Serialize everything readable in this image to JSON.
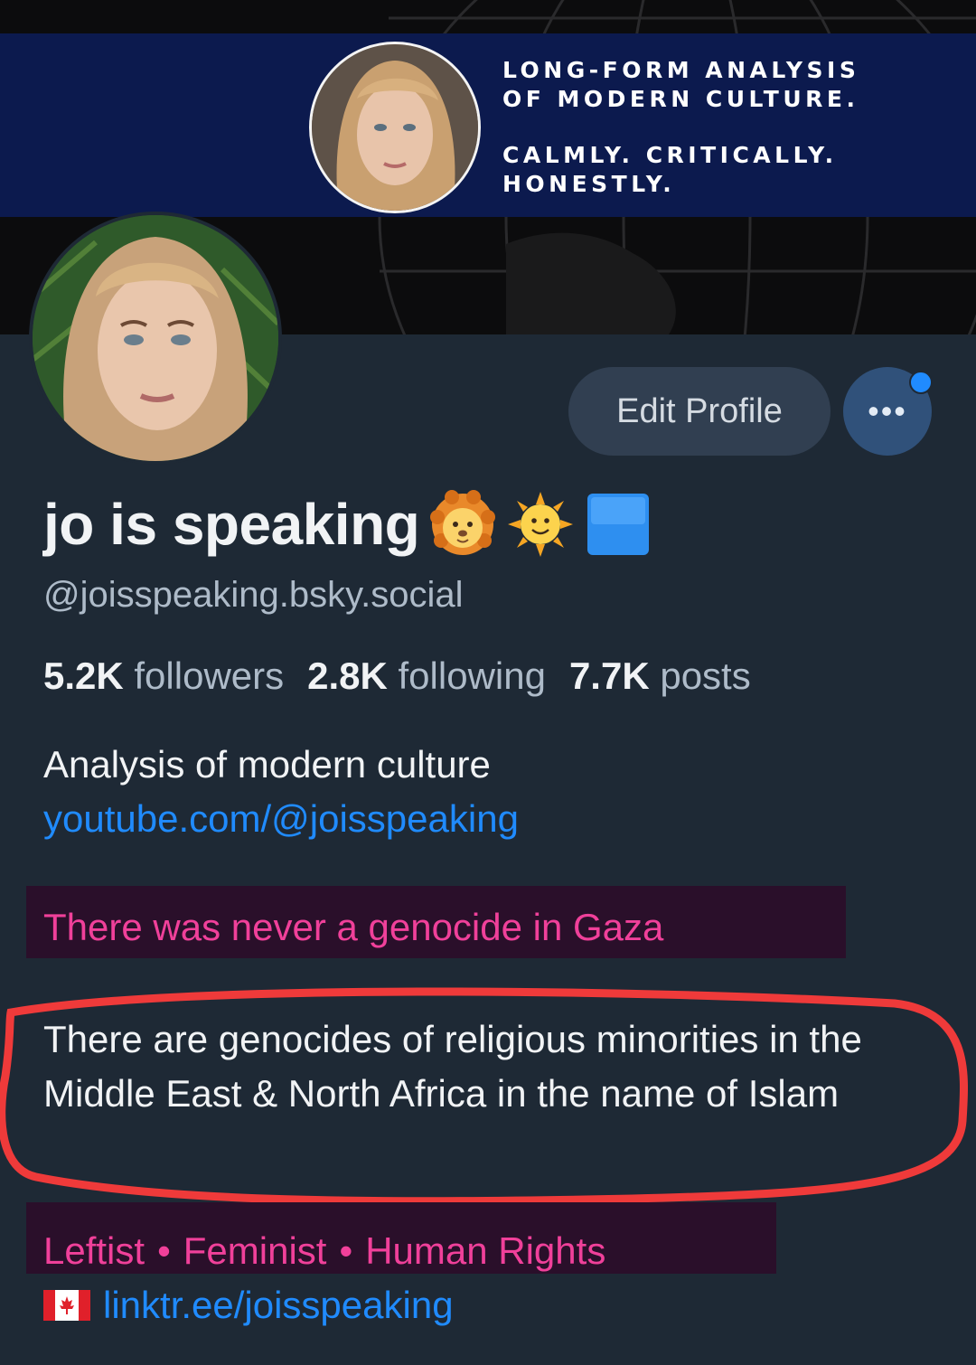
{
  "banner": {
    "tagline_line1": "LONG-FORM ANALYSIS",
    "tagline_line2": "OF MODERN CULTURE.",
    "tagline_line3": "CALMLY. CRITICALLY.",
    "tagline_line4": "HONESTLY."
  },
  "profile": {
    "display_name": "jo is speaking",
    "name_emojis": [
      "lion-face-emoji",
      "sun-with-face-emoji",
      "blue-square-emoji"
    ],
    "handle": "@joisspeaking.bsky.social",
    "stats": {
      "followers_count": "5.2K",
      "followers_label": "followers",
      "following_count": "2.8K",
      "following_label": "following",
      "posts_count": "7.7K",
      "posts_label": "posts"
    },
    "edit_button_label": "Edit Profile",
    "more_button_label": "•••"
  },
  "bio": {
    "line1": "Analysis of modern culture",
    "link1": "youtube.com/@joisspeaking",
    "highlight1": "There was never a genocide in Gaza",
    "paragraph": "There are genocides of religious minorities in the Middle East & North Africa in the name of Islam",
    "tags": [
      "Leftist",
      "Feminist",
      "Human Rights"
    ],
    "tag_separator": "•",
    "flag_icon": "canada-flag-icon",
    "link2": "linktr.ee/joisspeaking"
  },
  "colors": {
    "background": "#1e2935",
    "link_blue": "#208bfe",
    "pink": "#f0409a",
    "annotation_red": "#ef3a3a",
    "banner_navy": "#0c1a4e"
  }
}
